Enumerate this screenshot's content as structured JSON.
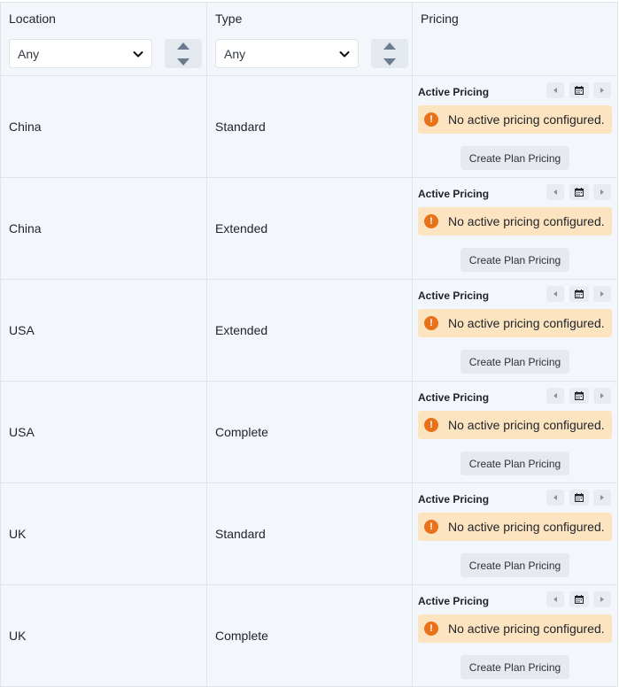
{
  "headers": {
    "location": "Location",
    "type": "Type",
    "pricing": "Pricing"
  },
  "filters": {
    "location_value": "Any",
    "type_value": "Any"
  },
  "pricing_labels": {
    "active_title": "Active Pricing",
    "alert_message": "No active pricing configured.",
    "alert_icon": "!",
    "create_button": "Create Plan Pricing"
  },
  "colors": {
    "alert_bg": "#fde4c0",
    "alert_icon": "#e8721a",
    "table_bg": "#f3f7fb"
  },
  "rows": [
    {
      "location": "China",
      "type": "Standard"
    },
    {
      "location": "China",
      "type": "Extended"
    },
    {
      "location": "USA",
      "type": "Extended"
    },
    {
      "location": "USA",
      "type": "Complete"
    },
    {
      "location": "UK",
      "type": "Standard"
    },
    {
      "location": "UK",
      "type": "Complete"
    }
  ]
}
